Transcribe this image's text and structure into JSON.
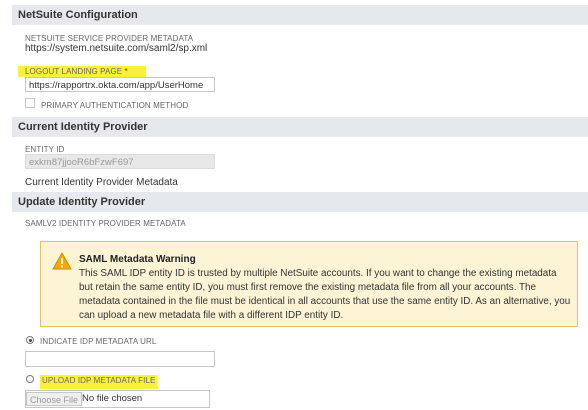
{
  "sections": {
    "netsuite_config": "NetSuite Configuration",
    "current_idp": "Current Identity Provider",
    "update_idp": "Update Identity Provider"
  },
  "netsuite": {
    "sp_metadata_label": "NETSUITE SERVICE PROVIDER METADATA",
    "sp_metadata_url": "https://system.netsuite.com/saml2/sp.xml",
    "logout_label": "LOGOUT LANDING PAGE",
    "required_star": "*",
    "logout_value": "https://rapportrx.okta.com/app/UserHome",
    "primary_auth_label": "PRIMARY AUTHENTICATION METHOD"
  },
  "current": {
    "entity_id_label": "ENTITY ID",
    "entity_id_value": "exkm87jjooR6bFzwF697",
    "metadata_text": "Current Identity Provider Metadata"
  },
  "update": {
    "saml_label": "SAMLV2 IDENTITY PROVIDER METADATA",
    "warning_title": "SAML Metadata Warning",
    "warning_body": "This SAML IDP entity ID is trusted by multiple NetSuite accounts. If you want to change the existing metadata but retain the same entity ID, you must first remove the existing metadata file from all your accounts. The metadata contained in the file must be identical in all accounts that use the same entity ID. As an alternative, you can upload a new metadata file with a different IDP entity ID.",
    "indicate_url_label": "INDICATE IDP METADATA URL",
    "indicate_url_value": "",
    "upload_label": "UPLOAD IDP METADATA FILE",
    "choose_file_label": "Choose File",
    "no_file_text": "No file chosen"
  },
  "colors": {
    "highlight": "#f9f03b",
    "warning_bg": "#fdf3d5",
    "warning_icon": "#f2a900",
    "header_bg": "#e5e9ee"
  },
  "icons": {
    "warning": "warning-triangle-icon"
  }
}
